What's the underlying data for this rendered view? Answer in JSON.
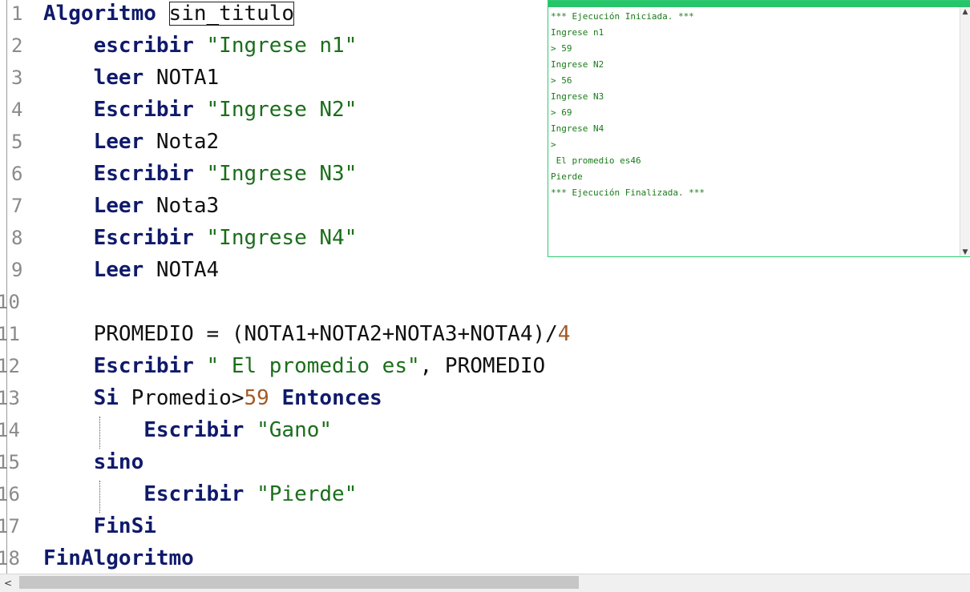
{
  "editor": {
    "lines": [
      {
        "num": "1",
        "parts": [
          {
            "t": "Algoritmo",
            "c": "kw"
          },
          {
            "t": " ",
            "c": "id"
          },
          {
            "t": "sin_titulo",
            "c": "id boxed"
          }
        ]
      },
      {
        "num": "2",
        "parts": [
          {
            "t": "    ",
            "c": "id"
          },
          {
            "t": "escribir",
            "c": "kw"
          },
          {
            "t": " ",
            "c": "id"
          },
          {
            "t": "\"Ingrese n1\"",
            "c": "str"
          }
        ]
      },
      {
        "num": "3",
        "parts": [
          {
            "t": "    ",
            "c": "id"
          },
          {
            "t": "leer",
            "c": "kw"
          },
          {
            "t": " NOTA1",
            "c": "id"
          }
        ]
      },
      {
        "num": "4",
        "parts": [
          {
            "t": "    ",
            "c": "id"
          },
          {
            "t": "Escribir",
            "c": "kw"
          },
          {
            "t": " ",
            "c": "id"
          },
          {
            "t": "\"Ingrese N2\"",
            "c": "str"
          }
        ]
      },
      {
        "num": "5",
        "parts": [
          {
            "t": "    ",
            "c": "id"
          },
          {
            "t": "Leer",
            "c": "kw"
          },
          {
            "t": " Nota2",
            "c": "id"
          }
        ]
      },
      {
        "num": "6",
        "parts": [
          {
            "t": "    ",
            "c": "id"
          },
          {
            "t": "Escribir",
            "c": "kw"
          },
          {
            "t": " ",
            "c": "id"
          },
          {
            "t": "\"Ingrese N3\"",
            "c": "str"
          }
        ]
      },
      {
        "num": "7",
        "parts": [
          {
            "t": "    ",
            "c": "id"
          },
          {
            "t": "Leer",
            "c": "kw"
          },
          {
            "t": " Nota3",
            "c": "id"
          }
        ]
      },
      {
        "num": "8",
        "parts": [
          {
            "t": "    ",
            "c": "id"
          },
          {
            "t": "Escribir",
            "c": "kw"
          },
          {
            "t": " ",
            "c": "id"
          },
          {
            "t": "\"Ingrese N4\"",
            "c": "str"
          }
        ]
      },
      {
        "num": "9",
        "parts": [
          {
            "t": "    ",
            "c": "id"
          },
          {
            "t": "Leer",
            "c": "kw"
          },
          {
            "t": " NOTA4",
            "c": "id"
          }
        ]
      },
      {
        "num": "10",
        "parts": []
      },
      {
        "num": "11",
        "parts": [
          {
            "t": "    PROMEDIO = (NOTA1+NOTA2+NOTA3+NOTA4)/",
            "c": "id"
          },
          {
            "t": "4",
            "c": "num"
          }
        ]
      },
      {
        "num": "12",
        "parts": [
          {
            "t": "    ",
            "c": "id"
          },
          {
            "t": "Escribir",
            "c": "kw"
          },
          {
            "t": " ",
            "c": "id"
          },
          {
            "t": "\" El promedio es\"",
            "c": "str"
          },
          {
            "t": ", PROMEDIO",
            "c": "id"
          }
        ]
      },
      {
        "num": "13",
        "parts": [
          {
            "t": "    ",
            "c": "id"
          },
          {
            "t": "Si",
            "c": "kw"
          },
          {
            "t": " Promedio>",
            "c": "id"
          },
          {
            "t": "59",
            "c": "num"
          },
          {
            "t": " ",
            "c": "id"
          },
          {
            "t": "Entonces",
            "c": "kw"
          }
        ]
      },
      {
        "num": "14",
        "parts": [
          {
            "t": "        ",
            "c": "id"
          },
          {
            "t": "Escribir",
            "c": "kw"
          },
          {
            "t": " ",
            "c": "id"
          },
          {
            "t": "\"Gano\"",
            "c": "str"
          }
        ]
      },
      {
        "num": "15",
        "parts": [
          {
            "t": "    ",
            "c": "id"
          },
          {
            "t": "sino",
            "c": "kw"
          }
        ]
      },
      {
        "num": "16",
        "parts": [
          {
            "t": "        ",
            "c": "id"
          },
          {
            "t": "Escribir",
            "c": "kw"
          },
          {
            "t": " ",
            "c": "id"
          },
          {
            "t": "\"Pierde\"",
            "c": "str"
          }
        ]
      },
      {
        "num": "17",
        "parts": [
          {
            "t": "    ",
            "c": "id"
          },
          {
            "t": "FinSi",
            "c": "kw"
          }
        ]
      },
      {
        "num": "18",
        "parts": [
          {
            "t": "FinAlgoritmo",
            "c": "kw"
          }
        ]
      }
    ]
  },
  "console": {
    "output": [
      "*** Ejecución Iniciada. ***",
      "Ingrese n1",
      "> 59",
      "Ingrese N2",
      "> 56",
      "Ingrese N3",
      "> 69",
      "Ingrese N4",
      ">",
      " El promedio es46",
      "Pierde",
      "*** Ejecución Finalizada. ***"
    ],
    "text_color": "#1b7a1b",
    "accent_color": "#27c46b"
  },
  "icons": {
    "scroll_up": "▲",
    "scroll_down": "▼",
    "scroll_left": "<"
  }
}
